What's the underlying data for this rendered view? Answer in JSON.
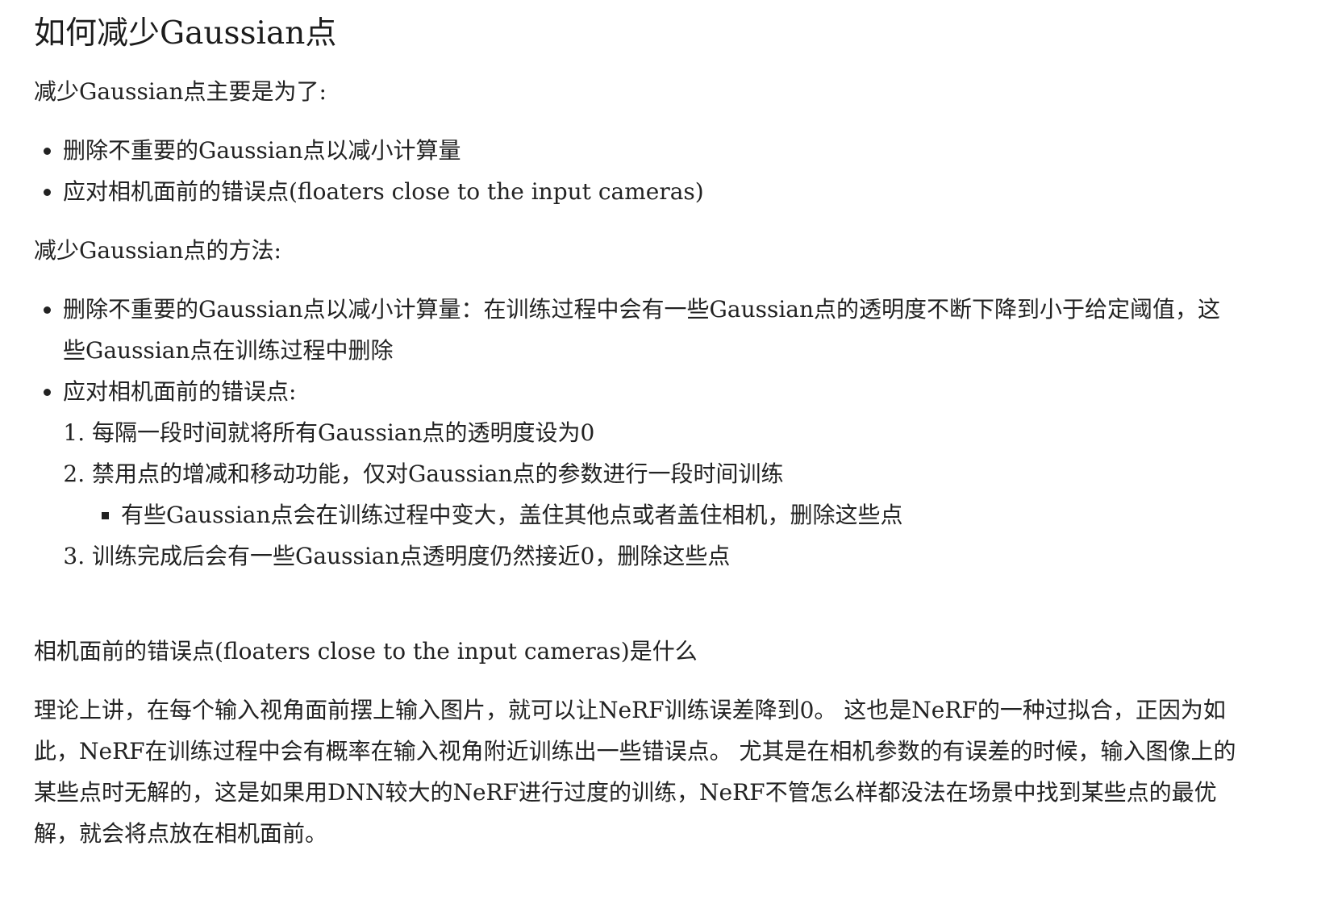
{
  "heading": "如何减少Gaussian点",
  "purpose_intro": "减少Gaussian点主要是为了:",
  "purpose_items": [
    "删除不重要的Gaussian点以减小计算量",
    "应对相机面前的错误点(floaters close to the input cameras)"
  ],
  "methods_intro": "减少Gaussian点的方法:",
  "methods": {
    "item1": "删除不重要的Gaussian点以减小计算量：在训练过程中会有一些Gaussian点的透明度不断下降到小于给定阈值，这些Gaussian点在训练过程中删除",
    "item2": "应对相机面前的错误点:",
    "steps": [
      "每隔一段时间就将所有Gaussian点的透明度设为0",
      "禁用点的增减和移动功能，仅对Gaussian点的参数进行一段时间训练",
      "训练完成后会有一些Gaussian点透明度仍然接近0，删除这些点"
    ],
    "step2_sub": "有些Gaussian点会在训练过程中变大，盖住其他点或者盖住相机，删除这些点"
  },
  "section2_title": "相机面前的错误点(floaters close to the input cameras)是什么",
  "section2_body": "理论上讲，在每个输入视角面前摆上输入图片，就可以让NeRF训练误差降到0。 这也是NeRF的一种过拟合，正因为如此，NeRF在训练过程中会有概率在输入视角附近训练出一些错误点。 尤其是在相机参数的有误差的时候，输入图像上的某些点时无解的，这是如果用DNN较大的NeRF进行过度的训练，NeRF不管怎么样都没法在场景中找到某些点的最优解，就会将点放在相机面前。"
}
